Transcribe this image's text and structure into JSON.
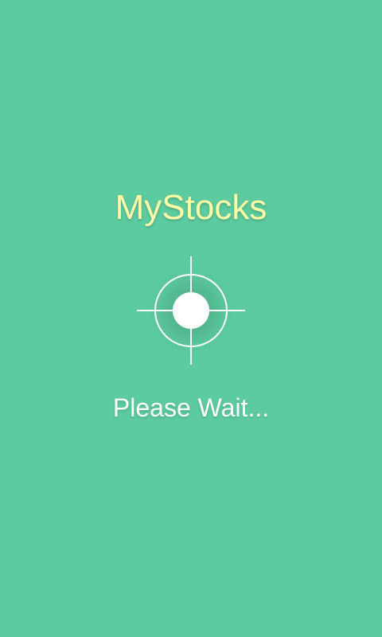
{
  "app": {
    "title": "MyStocks"
  },
  "loading": {
    "message": "Please Wait...",
    "indicator_icon": "crosshair-target-icon"
  },
  "colors": {
    "background": "#5ccb9f",
    "title": "#fffaa6",
    "indicator": "#ffffff",
    "message": "#ffffff"
  }
}
